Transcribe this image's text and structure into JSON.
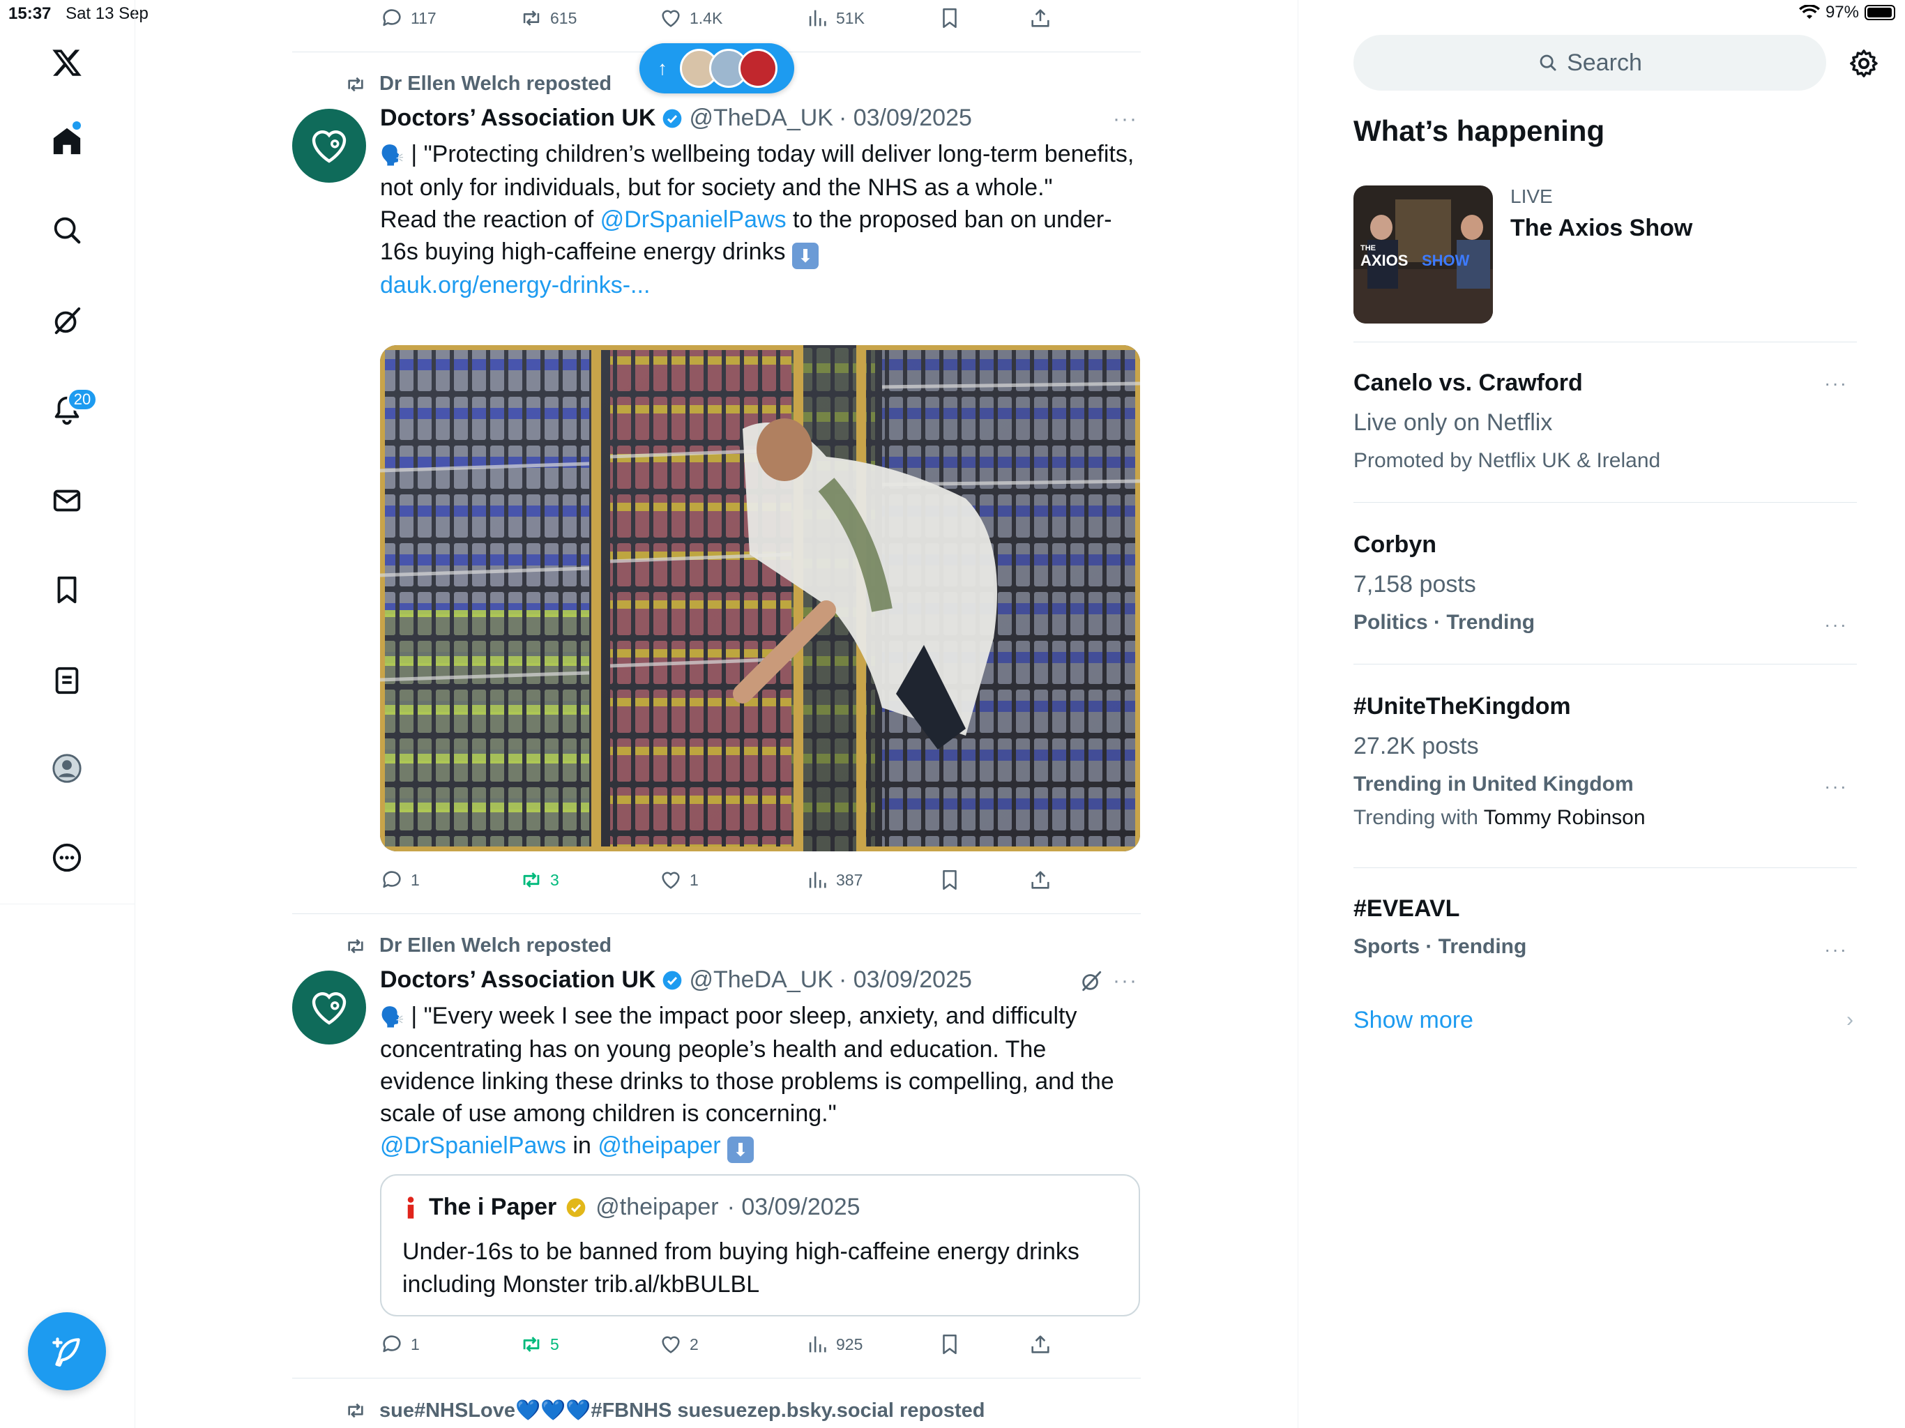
{
  "status": {
    "time": "15:37",
    "date": "Sat 13 Sep",
    "battery": "97%",
    "battery_level": 0.97
  },
  "nav": {
    "notifications_badge": "20"
  },
  "top_actions": {
    "replies": "117",
    "reposts": "615",
    "likes": "1.4K",
    "views": "51K"
  },
  "posts": [
    {
      "repost_by": "Dr Ellen Welch reposted",
      "name": "Doctors’ Association UK",
      "handle": "@TheDA_UK",
      "date": "· 03/09/2025",
      "text_1": " | \"Protecting children’s wellbeing today will deliver long-term benefits, not only for individuals, but for society and the NHS as a whole.\"",
      "text_2a": "Read the reaction of ",
      "mention": "@DrSpanielPaws",
      "text_2b": " to the proposed ban on under-16s buying high-caffeine energy drinks ",
      "link": "dauk.org/energy-drinks-...",
      "replies": "1",
      "reposts": "3",
      "likes": "1",
      "views": "387"
    },
    {
      "repost_by": "Dr Ellen Welch reposted",
      "name": "Doctors’ Association UK",
      "handle": "@TheDA_UK",
      "date": "· 03/09/2025",
      "text_1": " | \"Every week I see the impact poor sleep, anxiety, and difficulty concentrating has on young people’s health and education. The evidence linking these drinks to those problems is compelling, and the scale of use among children is concerning.\"",
      "mention": "@DrSpanielPaws",
      "in_word": " in ",
      "mention2": "@theipaper",
      "quote": {
        "name": "The i Paper",
        "handle": "@theipaper",
        "date": "· 03/09/2025",
        "text": "Under-16s to be banned from buying high-caffeine energy drinks including Monster trib.al/kbBULBL"
      },
      "replies": "1",
      "reposts": "5",
      "likes": "2",
      "views": "925"
    }
  ],
  "next_repost": "sue#NHSLove💙💙💙#FBNHS suesuezep.bsky.social reposted",
  "right": {
    "search_placeholder": "Search",
    "title": "What’s happening",
    "live": {
      "label": "LIVE",
      "title": "The Axios Show",
      "thumb_text_1": "THE",
      "thumb_text_2": "AXIOS",
      "thumb_text_3": "SHOW"
    },
    "trends": [
      {
        "title": "Canelo vs. Crawford",
        "sub": "Live only on Netflix",
        "meta": "Promoted by Netflix UK & Ireland"
      },
      {
        "title": "Corbyn",
        "sub": "7,158 posts",
        "meta": "Politics · Trending"
      },
      {
        "title": "#UniteTheKingdom",
        "sub": "27.2K posts",
        "meta": "Trending in United Kingdom",
        "extra_pre": "Trending with ",
        "extra_name": "Tommy Robinson"
      },
      {
        "title": "#EVEAVL",
        "meta": "Sports · Trending"
      }
    ],
    "show_more": "Show more"
  },
  "colors": {
    "accent": "#1d9bf0",
    "repost_green": "#00ba7c",
    "avatar_teal": "#0f6b5a",
    "muted": "#536471"
  }
}
